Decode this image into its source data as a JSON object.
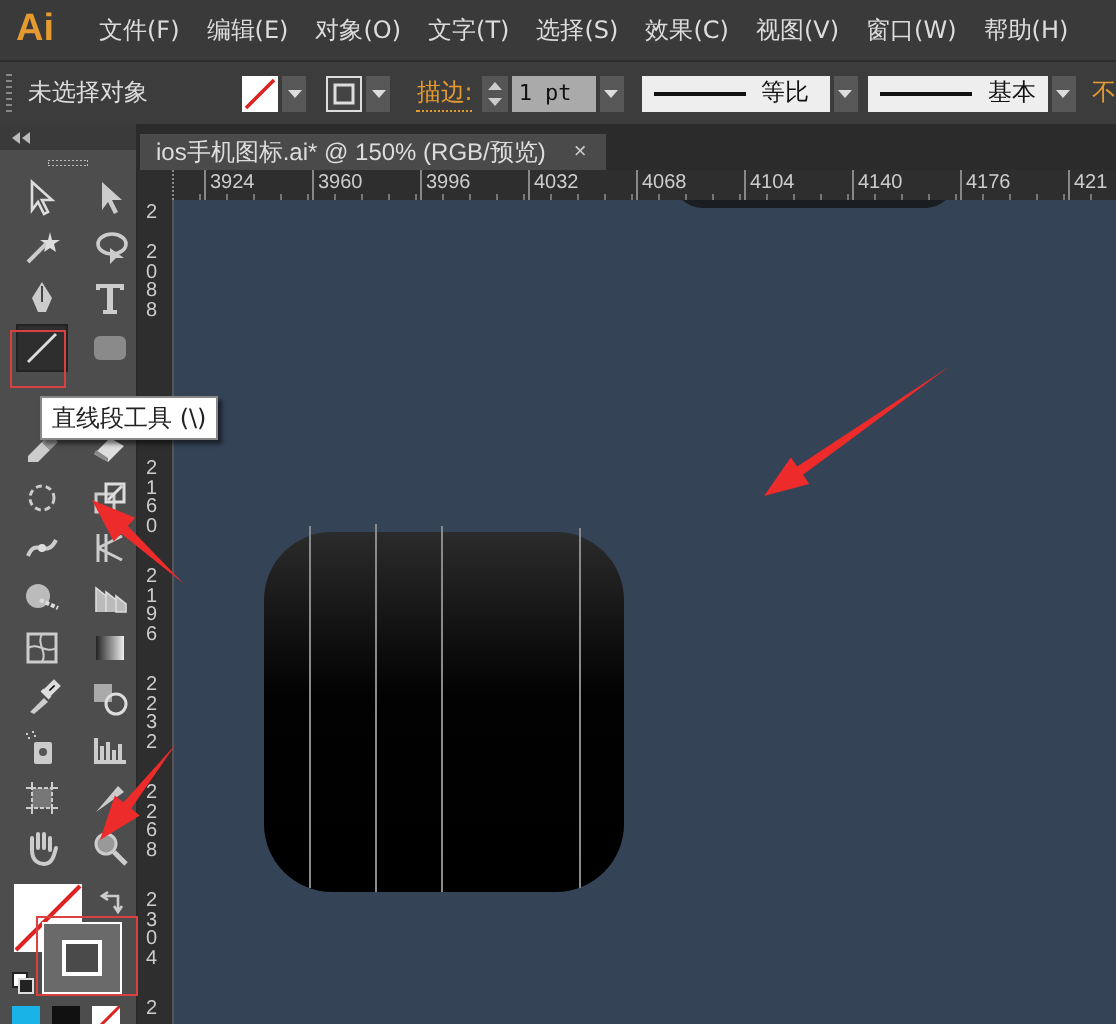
{
  "app": {
    "logo": "Ai"
  },
  "menu": [
    "文件(F)",
    "编辑(E)",
    "对象(O)",
    "文字(T)",
    "选择(S)",
    "效果(C)",
    "视图(V)",
    "窗口(W)",
    "帮助(H)"
  ],
  "control_bar": {
    "selection": "未选择对象",
    "stroke_label": "描边:",
    "stroke_weight": "1 pt",
    "profile": "等比",
    "brush": "基本",
    "opacity_label": "不"
  },
  "document_tab": {
    "title": "ios手机图标.ai* @ 150% (RGB/预览)",
    "close": "×"
  },
  "ruler": {
    "horizontal": [
      "3924",
      "3960",
      "3996",
      "4032",
      "4068",
      "4104",
      "4140",
      "4176",
      "421"
    ],
    "vertical": [
      "2",
      "2088",
      "2160",
      "2196",
      "2232",
      "2268",
      "2304",
      "2"
    ]
  },
  "tooltip": "直线段工具 (\\)",
  "tools": [
    {
      "kind": "selection",
      "selected": false
    },
    {
      "kind": "direct",
      "selected": false
    },
    {
      "kind": "wand",
      "selected": false
    },
    {
      "kind": "lasso",
      "selected": false
    },
    {
      "kind": "pen",
      "selected": false
    },
    {
      "kind": "type",
      "selected": false
    },
    {
      "kind": "line",
      "selected": true
    },
    {
      "kind": "rect",
      "selected": false
    },
    {
      "kind": "blob",
      "selected": false
    },
    {
      "kind": "eraser",
      "selected": false
    },
    {
      "kind": "rotate",
      "selected": false
    },
    {
      "kind": "scale",
      "selected": false
    },
    {
      "kind": "width",
      "selected": false
    },
    {
      "kind": "warp",
      "selected": false
    },
    {
      "kind": "builder",
      "selected": false
    },
    {
      "kind": "grid",
      "selected": false
    },
    {
      "kind": "mesh",
      "selected": false
    },
    {
      "kind": "gradient",
      "selected": false
    },
    {
      "kind": "eyedropper",
      "selected": false
    },
    {
      "kind": "blend",
      "selected": false
    },
    {
      "kind": "sprayer",
      "selected": false
    },
    {
      "kind": "graph",
      "selected": false
    },
    {
      "kind": "artboard",
      "selected": false
    },
    {
      "kind": "slice",
      "selected": false
    },
    {
      "kind": "hand",
      "selected": false
    },
    {
      "kind": "zoom",
      "selected": false
    }
  ]
}
